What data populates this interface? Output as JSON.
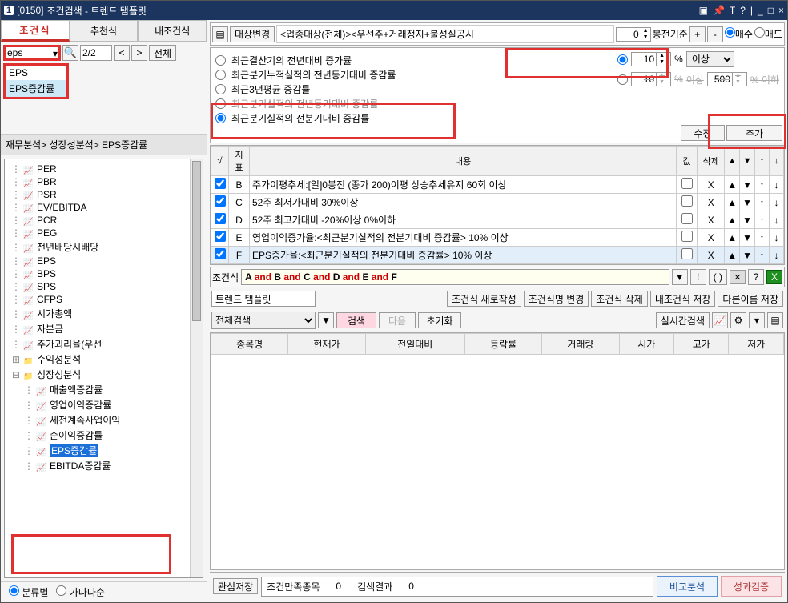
{
  "title": {
    "code": "1",
    "id": "[0150]",
    "name": "조건검색 - 트렌드 탬플릿"
  },
  "leftTabs": {
    "t1": "조건식",
    "t2": "추천식",
    "t3": "내조건식"
  },
  "search": {
    "combo": "eps",
    "mag": "🔍",
    "counter": "2/2",
    "prev": "<",
    "next": ">",
    "all": "전체"
  },
  "dropdownItems": {
    "i0": "EPS",
    "i1": "EPS증감률"
  },
  "breadcrumb": "재무분석> 성장성분석> EPS증감률",
  "treeLeaves": {
    "l0": "PER",
    "l1": "PBR",
    "l2": "PSR",
    "l3": "EV/EBITDA",
    "l4": "PCR",
    "l5": "PEG",
    "l6": "전년배당시배당",
    "l7": "EPS",
    "l8": "BPS",
    "l9": "SPS",
    "l10": "CFPS",
    "l11": "시가총액",
    "l12": "자본금",
    "l13": "주가괴리율(우선"
  },
  "treeFolders": {
    "f0": "수익성분석",
    "f1": "성장성분석",
    "f1_c0": "매출액증감률",
    "f1_c1": "영업이익증감률",
    "f1_c2": "세전계속사업이익",
    "f1_c3": "순이익증감률",
    "f1_c4": "EPS증감률",
    "f1_c5": "EBITDA증감률"
  },
  "sortMode": {
    "a": "분류별",
    "b": "가나다순"
  },
  "topToolbar": {
    "target": "대상변경",
    "desc": "<업종대상(전체)><우선주+거래정지+불성실공시",
    "num": "0",
    "basis": "봉전기준",
    "plus": "+",
    "minus": "-",
    "buy": "매수",
    "sell": "매도"
  },
  "optionRadios": {
    "o0": "최근결산기의 전년대비 증가률",
    "o1": "최근분기누적실적의 전년동기대비 증감률",
    "o2": "최근3년평균 증감률",
    "o3": "최근분기실적의 전년동기대비 증감률",
    "o4": "최근분기실적의 전분기대비 증감률"
  },
  "rightCtrl": {
    "val1": "10",
    "pct": "%",
    "cmp": "이상",
    "val2": "10",
    "pct2": "%",
    "cmp2": "이상",
    "val3": "500",
    "pct3": "% 이하"
  },
  "actions": {
    "modify": "수정",
    "add": "추가"
  },
  "condHeader": {
    "c1": "√",
    "c2": "지표",
    "c3": "내용",
    "c4": "값",
    "c5": "삭제",
    "c6": "▲",
    "c7": "▼",
    "c8": "↑",
    "c9": "↓"
  },
  "condRows": {
    "rBlbl": "B",
    "rB": "주가이평추세:[일]0봉전 (종가 200)이평 상승추세유지 60회 이상",
    "rClbl": "C",
    "rC": "52주 최저가대비 30%이상",
    "rDlbl": "D",
    "rD": "52주 최고가대비 -20%이상 0%이하",
    "rElbl": "E",
    "rE": "영업이익증가율:<최근분기실적의 전분기대비 증감률> 10% 이상",
    "rFlbl": "F",
    "rF": "EPS증가율:<최근분기실적의 전분기대비 증감률> 10% 이상"
  },
  "formula": {
    "label": "조건식",
    "a": "A",
    "b": "B",
    "c": "C",
    "d": "D",
    "e": "E",
    "f": "F",
    "and": " and "
  },
  "formulaBtns": {
    "down": "▼",
    "excl": "!",
    "paren": "( )",
    "quest": "?"
  },
  "nameVal": "트렌드 탬플릿",
  "nameBtns": {
    "b0": "조건식 새로작성",
    "b1": "조건식명 변경",
    "b2": "조건식 삭제",
    "b3": "내조건식 저장",
    "b4": "다른이름 저장"
  },
  "search2": {
    "scope": "전체검색",
    "go": "검색",
    "next": "다음",
    "reset": "초기화",
    "live": "실시간검색",
    "chart": "📈"
  },
  "resultHdr": {
    "h0": "종목명",
    "h1": "현재가",
    "h2": "전일대비",
    "h3": "등락률",
    "h4": "거래량",
    "h5": "시가",
    "h6": "고가",
    "h7": "저가"
  },
  "bottom": {
    "save": "관심저장",
    "f1l": "조건만족종목",
    "f1v": "0",
    "f2l": "검색결과",
    "f2v": "0",
    "b1": "비교분석",
    "b2": "성과검증"
  }
}
